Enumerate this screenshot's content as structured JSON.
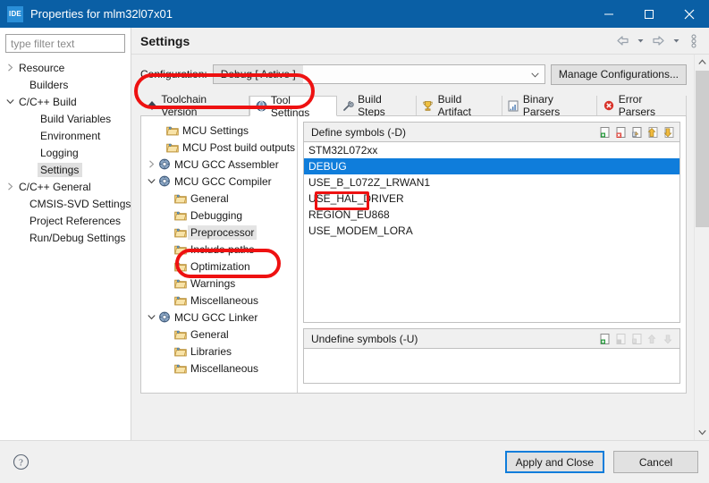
{
  "window": {
    "app_icon_label": "IDE",
    "title": "Properties for mlm32l07x01",
    "minimize_label": "Minimize",
    "maximize_label": "Maximize",
    "close_label": "Close"
  },
  "sidebar": {
    "filter_placeholder": "type filter text",
    "items": [
      {
        "label": "Resource",
        "indent": 0,
        "arrow": "collapsed",
        "selected": false
      },
      {
        "label": "Builders",
        "indent": 1,
        "arrow": "none",
        "selected": false
      },
      {
        "label": "C/C++ Build",
        "indent": 0,
        "arrow": "expanded",
        "selected": false
      },
      {
        "label": "Build Variables",
        "indent": 2,
        "arrow": "none",
        "selected": false
      },
      {
        "label": "Environment",
        "indent": 2,
        "arrow": "none",
        "selected": false
      },
      {
        "label": "Logging",
        "indent": 2,
        "arrow": "none",
        "selected": false
      },
      {
        "label": "Settings",
        "indent": 2,
        "arrow": "none",
        "selected": true
      },
      {
        "label": "C/C++ General",
        "indent": 0,
        "arrow": "collapsed",
        "selected": false
      },
      {
        "label": "CMSIS-SVD Settings",
        "indent": 1,
        "arrow": "none",
        "selected": false
      },
      {
        "label": "Project References",
        "indent": 1,
        "arrow": "none",
        "selected": false
      },
      {
        "label": "Run/Debug Settings",
        "indent": 1,
        "arrow": "none",
        "selected": false
      }
    ]
  },
  "page": {
    "title": "Settings",
    "nav": {
      "back_icon": "back-arrow-icon",
      "back_menu_icon": "chevron-down-icon",
      "forward_icon": "forward-arrow-icon",
      "forward_menu_icon": "chevron-down-icon",
      "view_menu_icon": "view-menu-icon"
    }
  },
  "configuration": {
    "label": "Configuration:",
    "value": "Debug  [ Active ]",
    "manage_button": "Manage Configurations..."
  },
  "tabs": [
    {
      "label": "Toolchain Version",
      "icon": "diamond-icon",
      "active": false
    },
    {
      "label": "Tool Settings",
      "icon": "gear-globe-icon",
      "active": true
    },
    {
      "label": "Build Steps",
      "icon": "wrench-icon",
      "active": false
    },
    {
      "label": "Build Artifact",
      "icon": "trophy-icon",
      "active": false
    },
    {
      "label": "Binary Parsers",
      "icon": "binary-icon",
      "active": false
    },
    {
      "label": "Error Parsers",
      "icon": "error-icon",
      "active": false
    }
  ],
  "tool_tree": [
    {
      "label": "MCU Settings",
      "indent": 1,
      "arrow": "none",
      "icon": "folder-icon",
      "selected": false
    },
    {
      "label": "MCU Post build outputs",
      "indent": 1,
      "arrow": "none",
      "icon": "folder-icon",
      "selected": false
    },
    {
      "label": "MCU GCC Assembler",
      "indent": 0,
      "arrow": "collapsed",
      "icon": "tool-icon",
      "selected": false
    },
    {
      "label": "MCU GCC Compiler",
      "indent": 0,
      "arrow": "expanded",
      "icon": "tool-icon",
      "selected": false
    },
    {
      "label": "General",
      "indent": 2,
      "arrow": "none",
      "icon": "folder-icon",
      "selected": false
    },
    {
      "label": "Debugging",
      "indent": 2,
      "arrow": "none",
      "icon": "folder-icon",
      "selected": false
    },
    {
      "label": "Preprocessor",
      "indent": 2,
      "arrow": "none",
      "icon": "folder-icon",
      "selected": true
    },
    {
      "label": "Include paths",
      "indent": 2,
      "arrow": "none",
      "icon": "folder-icon",
      "selected": false
    },
    {
      "label": "Optimization",
      "indent": 2,
      "arrow": "none",
      "icon": "folder-icon",
      "selected": false
    },
    {
      "label": "Warnings",
      "indent": 2,
      "arrow": "none",
      "icon": "folder-icon",
      "selected": false
    },
    {
      "label": "Miscellaneous",
      "indent": 2,
      "arrow": "none",
      "icon": "folder-icon",
      "selected": false
    },
    {
      "label": "MCU GCC Linker",
      "indent": 0,
      "arrow": "expanded",
      "icon": "tool-icon",
      "selected": false
    },
    {
      "label": "General",
      "indent": 2,
      "arrow": "none",
      "icon": "folder-icon",
      "selected": false
    },
    {
      "label": "Libraries",
      "indent": 2,
      "arrow": "none",
      "icon": "folder-icon",
      "selected": false
    },
    {
      "label": "Miscellaneous",
      "indent": 2,
      "arrow": "none",
      "icon": "folder-icon",
      "selected": false
    }
  ],
  "define_symbols": {
    "header": "Define symbols (-D)",
    "icons": [
      "add-icon",
      "delete-icon",
      "edit-icon",
      "move-up-icon",
      "move-down-icon"
    ],
    "items": [
      {
        "label": "STM32L072xx",
        "selected": false
      },
      {
        "label": "DEBUG",
        "selected": true
      },
      {
        "label": "USE_B_L072Z_LRWAN1",
        "selected": false
      },
      {
        "label": "USE_HAL_DRIVER",
        "selected": false
      },
      {
        "label": "REGION_EU868",
        "selected": false
      },
      {
        "label": "USE_MODEM_LORA",
        "selected": false
      }
    ]
  },
  "undefine_symbols": {
    "header": "Undefine symbols (-U)",
    "icons": [
      "add-icon",
      "delete-icon",
      "edit-icon",
      "move-up-icon",
      "move-down-icon"
    ],
    "items": []
  },
  "footer": {
    "help_icon": "help-icon",
    "apply_button": "Apply and Close",
    "cancel_button": "Cancel"
  },
  "colors": {
    "titlebar": "#0a5fa5",
    "selection": "#0f7ddb",
    "annotation": "#ee1111",
    "dialog_bg": "#f0f0f0"
  }
}
